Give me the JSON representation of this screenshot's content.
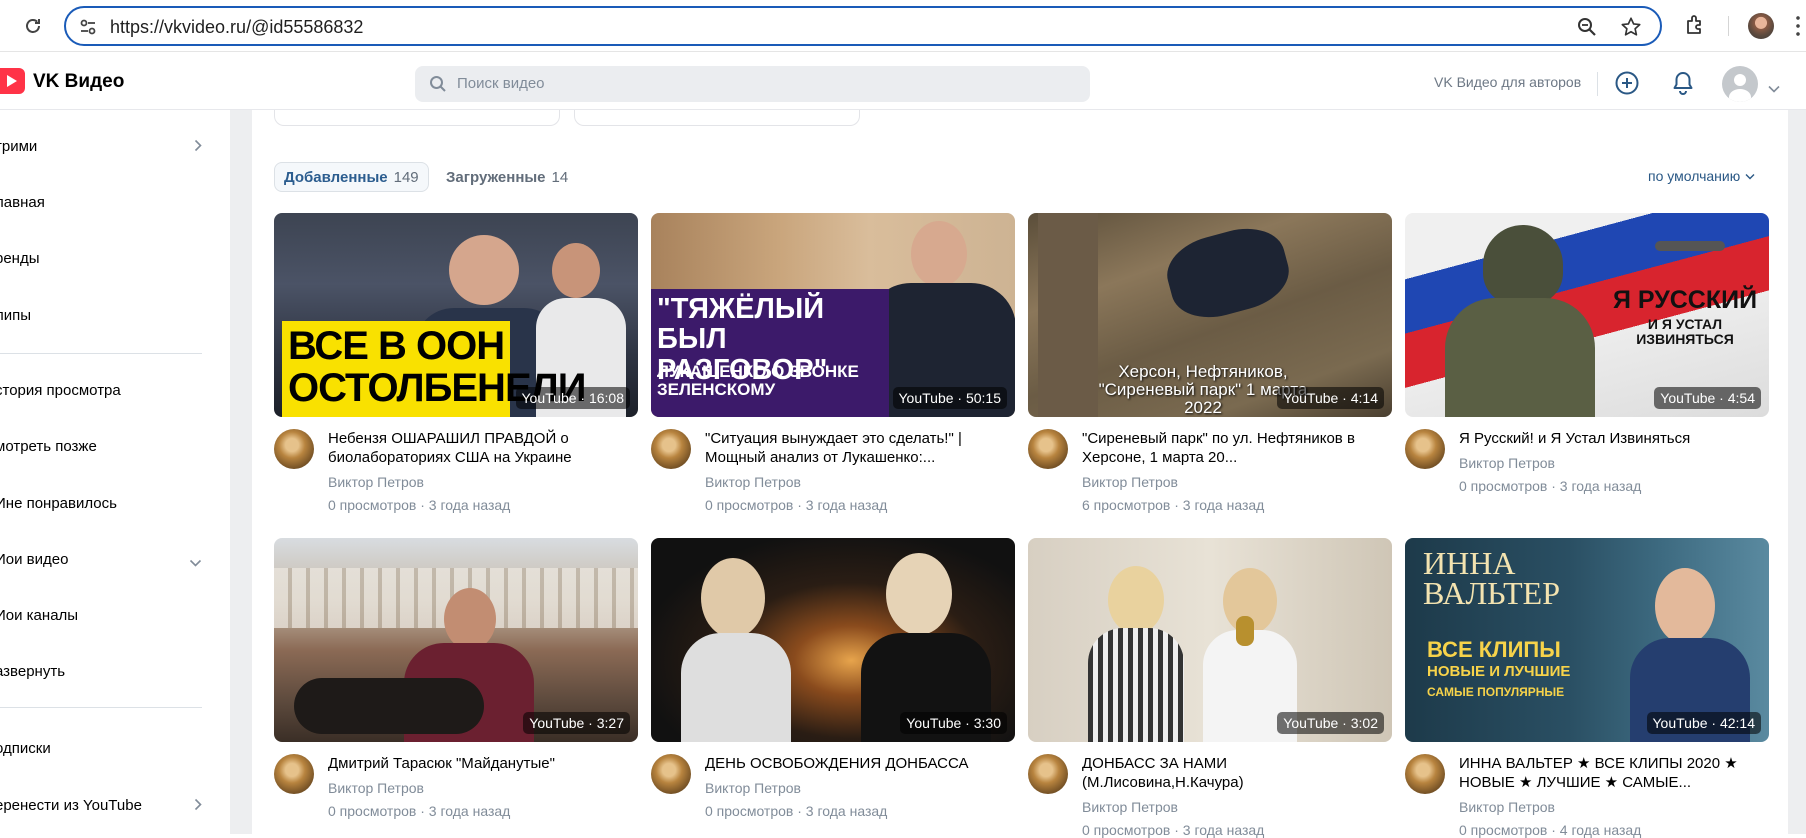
{
  "browser": {
    "url": "https://vkvideo.ru/@id55586832"
  },
  "header": {
    "brand": "VK Видео",
    "search_placeholder": "Поиск видео",
    "authors_link": "VK Видео для авторов"
  },
  "sidebar": {
    "items": [
      {
        "label": "трими"
      },
      {
        "label": "лавная"
      },
      {
        "label": "ренды"
      },
      {
        "label": "липы"
      },
      {
        "label": "стория просмотра"
      },
      {
        "label": "мотреть позже"
      },
      {
        "label": "Ине понравилось"
      },
      {
        "label": "Иои видео"
      },
      {
        "label": "Иои каналы"
      },
      {
        "label": "азвернуть"
      },
      {
        "label": "одписки"
      },
      {
        "label": "еренести из YouTube"
      }
    ]
  },
  "tabs": {
    "added_label": "Добавленные",
    "added_count": "149",
    "uploaded_label": "Загруженные",
    "uploaded_count": "14",
    "sort_label": "по умолчанию"
  },
  "videos": [
    {
      "title": "Небензя ОШАРАШИЛ ПРАВДОЙ о биолабораториях США на Украине",
      "author": "Виктор Петров",
      "stats": "0 просмотров · 3 года назад",
      "duration": "YouTube · 16:08",
      "thumb_text": "ВСЕ В ООН ОСТОЛБЕНЕЛИ"
    },
    {
      "title": "\"Ситуация вынуждает это сделать!\" | Мощный анализ от Лукашенко:...",
      "author": "Виктор Петров",
      "stats": "0 просмотров · 3 года назад",
      "duration": "YouTube · 50:15",
      "thumb_text": "\"ТЯЖЁЛЫЙ БЫЛ РАЗГОВОР\"",
      "thumb_sub": "ЛУКАШЕНКО О ЗВОНКЕ ЗЕЛЕНСКОМУ"
    },
    {
      "title": "\"Сиреневый парк\" по ул. Нефтяников в Херсоне, 1 марта 20...",
      "author": "Виктор Петров",
      "stats": "6 просмотров · 3 года назад",
      "duration": "YouTube · 4:14",
      "thumb_text": "Херсон, Нефтяников, \"Сиреневый парк\" 1 марта 2022"
    },
    {
      "title": "Я Русский! и Я Устал Извиняться",
      "author": "Виктор Петров",
      "stats": "0 просмотров · 3 года назад",
      "duration": "YouTube · 4:54",
      "thumb_text": "Я РУССКИЙ",
      "thumb_sub": "И Я УСТАЛ ИЗВИНЯТЬСЯ"
    },
    {
      "title": "Дмитрий Тарасюк \"Майданутые\"",
      "author": "Виктор Петров",
      "stats": "0 просмотров · 3 года назад",
      "duration": "YouTube · 3:27"
    },
    {
      "title": "ДЕНЬ ОСВОБОЖДЕНИЯ ДОНБАССА",
      "author": "Виктор Петров",
      "stats": "0 просмотров · 3 года назад",
      "duration": "YouTube · 3:30"
    },
    {
      "title": "ДОНБАСС ЗА НАМИ (М.Лисовина,Н.Качура)",
      "author": "Виктор Петров",
      "stats": "0 просмотров · 3 года назад",
      "duration": "YouTube · 3:02"
    },
    {
      "title": "ИННА ВАЛЬТЕР ★ ВСЕ КЛИПЫ 2020 ★ НОВЫЕ ★ ЛУЧШИЕ ★ САМЫЕ...",
      "author": "Виктор Петров",
      "stats": "0 просмотров · 4 года назад",
      "duration": "YouTube · 42:14",
      "thumb_text": "ИННА ВАЛЬТЕР",
      "thumb_sub": "ВСЕ КЛИПЫ",
      "thumb_sub2": "НОВЫЕ И ЛУЧШИЕ",
      "thumb_sub3": "САМЫЕ ПОПУЛЯРНЫЕ"
    }
  ]
}
